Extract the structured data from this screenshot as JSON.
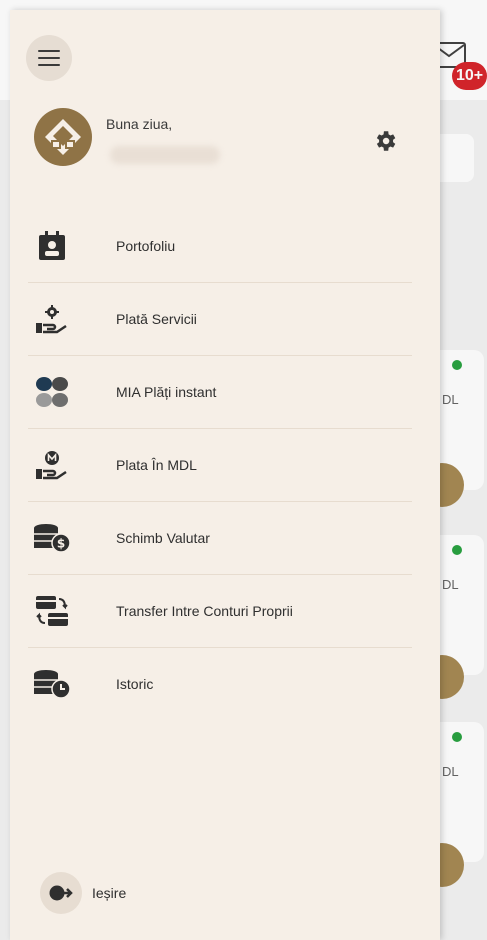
{
  "background": {
    "badge": "10+",
    "currency_labels": [
      "DL",
      "DL",
      "DL"
    ]
  },
  "drawer": {
    "greeting": "Buna ziua,",
    "items": [
      {
        "label": "Portofoliu",
        "icon": "portfolio-icon"
      },
      {
        "label": "Plată Servicii",
        "icon": "service-payment-icon"
      },
      {
        "label": "MIA Plăți instant",
        "icon": "mia-dots-icon"
      },
      {
        "label": "Plata În MDL",
        "icon": "mdl-payment-icon"
      },
      {
        "label": "Schimb Valutar",
        "icon": "currency-exchange-icon"
      },
      {
        "label": "Transfer Intre Conturi Proprii",
        "icon": "transfer-accounts-icon"
      },
      {
        "label": "Istoric",
        "icon": "history-icon"
      }
    ],
    "logout_label": "Ieșire"
  },
  "colors": {
    "drawer_bg": "#f6efe7",
    "icon_dark": "#2f2f2f",
    "brand_brown": "#8f7346",
    "badge_red": "#d7262c",
    "status_green": "#2aa342"
  }
}
